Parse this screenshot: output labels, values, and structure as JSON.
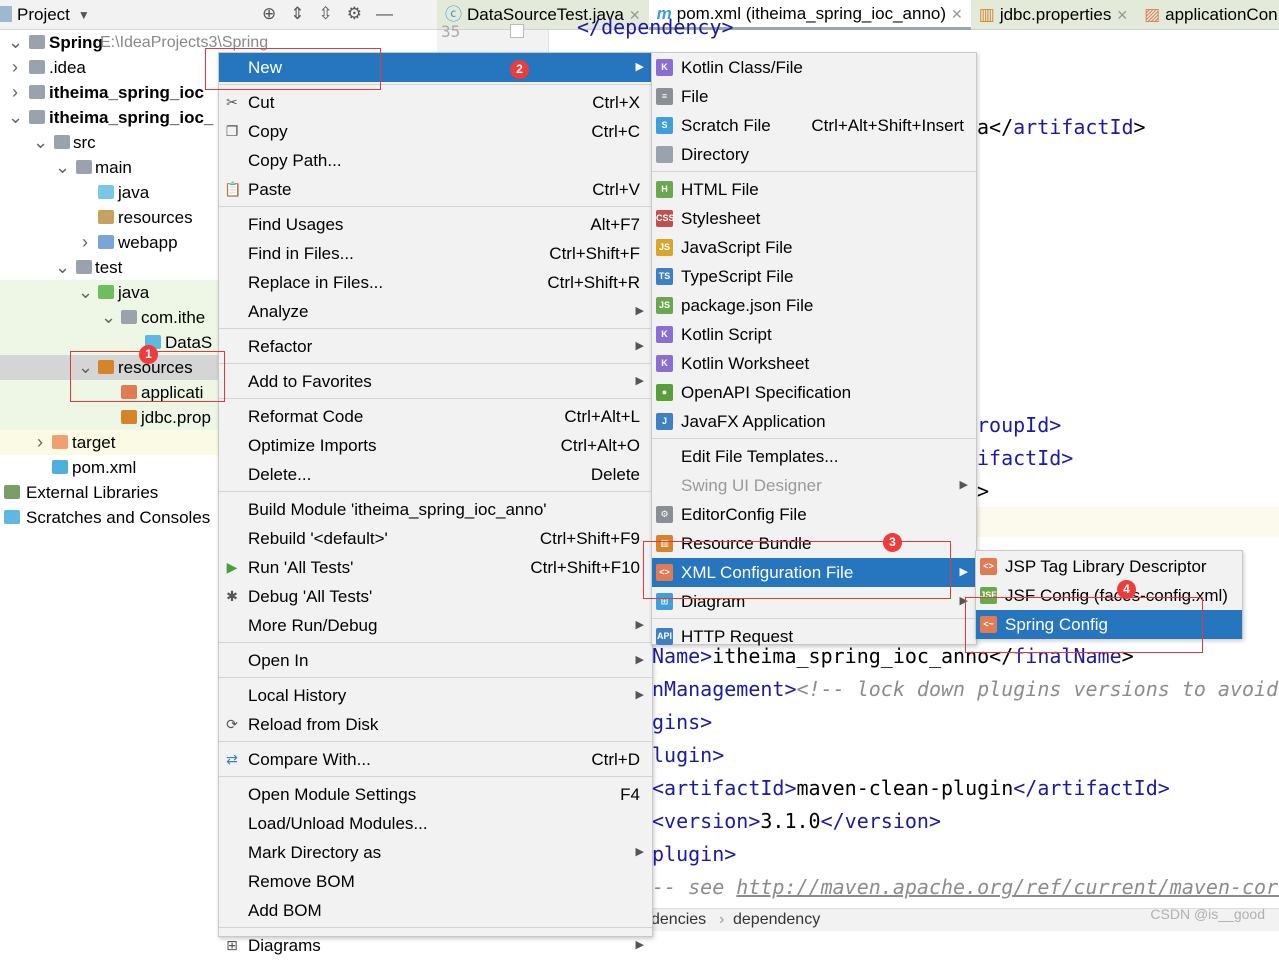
{
  "project_panel": {
    "title": "Project",
    "tools": [
      "locate-icon",
      "expand-all-icon",
      "collapse-all-icon",
      "gear-icon",
      "minimize-icon"
    ]
  },
  "tree": [
    {
      "label": "Spring",
      "path": "E:\\IdeaProjects3\\Spring",
      "bold": true
    },
    {
      "label": ".idea"
    },
    {
      "label": "itheima_spring_ioc",
      "bold": true
    },
    {
      "label": "itheima_spring_ioc_",
      "bold": true
    },
    {
      "label": "src"
    },
    {
      "label": "main"
    },
    {
      "label": "java"
    },
    {
      "label": "resources"
    },
    {
      "label": "webapp"
    },
    {
      "label": "test"
    },
    {
      "label": "java"
    },
    {
      "label": "com.ithe"
    },
    {
      "label": "DataS"
    },
    {
      "label": "resources"
    },
    {
      "label": "applicati"
    },
    {
      "label": "jdbc.prop"
    },
    {
      "label": "target"
    },
    {
      "label": "pom.xml"
    },
    {
      "label": "External Libraries"
    },
    {
      "label": "Scratches and Consoles"
    }
  ],
  "tabs": [
    {
      "label": "DataSourceTest.java"
    },
    {
      "label": "pom.xml (itheima_spring_ioc_anno)",
      "active": true
    },
    {
      "label": "jdbc.properties"
    },
    {
      "label": "applicationCon"
    }
  ],
  "gutter": {
    "line": "35"
  },
  "code": {
    "l1": "</dependency>",
    "l2a": "a</",
    "l2b": "artifactId",
    "l2c": ">",
    "l3": "roupId>",
    "l4": "ifactId>",
    "l5": ">",
    "l6a": "Name>",
    "l6b": "itheima_spring_ioc_anno",
    "l6c": "</",
    "l6d": "finalName",
    "l6e": ">",
    "l7a": "nManagement>",
    "l7b": "<!-- lock down plugins versions to avoid",
    "l8": "gins>",
    "l9": "lugin>",
    "l10a": "<artifactId>",
    "l10b": "maven-clean-plugin",
    "l10c": "</artifactId>",
    "l11a": "<version>",
    "l11b": "3.1.0",
    "l11c": "</version>",
    "l12": "plugin>",
    "l13a": "-- see ",
    "l13b": "http://maven.apache.org/ref/current/maven-core"
  },
  "breadcrumb": [
    "dencies",
    "dependency"
  ],
  "watermark": "CSDN @is__good",
  "context_menu": [
    {
      "label": "New",
      "arrow": true,
      "highlighted": true
    },
    "sep",
    {
      "label": "Cut",
      "shortcut": "Ctrl+X",
      "icon": "scissors-icon"
    },
    {
      "label": "Copy",
      "shortcut": "Ctrl+C",
      "icon": "copy-icon"
    },
    {
      "label": "Copy Path..."
    },
    {
      "label": "Paste",
      "shortcut": "Ctrl+V",
      "icon": "paste-icon"
    },
    "sep",
    {
      "label": "Find Usages",
      "shortcut": "Alt+F7"
    },
    {
      "label": "Find in Files...",
      "shortcut": "Ctrl+Shift+F"
    },
    {
      "label": "Replace in Files...",
      "shortcut": "Ctrl+Shift+R"
    },
    {
      "label": "Analyze",
      "arrow": true
    },
    "sep",
    {
      "label": "Refactor",
      "arrow": true
    },
    "sep",
    {
      "label": "Add to Favorites",
      "arrow": true
    },
    "sep",
    {
      "label": "Reformat Code",
      "shortcut": "Ctrl+Alt+L"
    },
    {
      "label": "Optimize Imports",
      "shortcut": "Ctrl+Alt+O"
    },
    {
      "label": "Delete...",
      "shortcut": "Delete"
    },
    "sep",
    {
      "label": "Build Module 'itheima_spring_ioc_anno'"
    },
    {
      "label": "Rebuild '<default>'",
      "shortcut": "Ctrl+Shift+F9"
    },
    {
      "label": "Run 'All Tests'",
      "shortcut": "Ctrl+Shift+F10",
      "icon": "run-icon"
    },
    {
      "label": "Debug 'All Tests'",
      "icon": "debug-icon"
    },
    {
      "label": "More Run/Debug",
      "arrow": true
    },
    "sep",
    {
      "label": "Open In",
      "arrow": true
    },
    "sep",
    {
      "label": "Local History",
      "arrow": true
    },
    {
      "label": "Reload from Disk",
      "icon": "reload-icon"
    },
    "sep",
    {
      "label": "Compare With...",
      "shortcut": "Ctrl+D",
      "icon": "compare-icon"
    },
    "sep",
    {
      "label": "Open Module Settings",
      "shortcut": "F4"
    },
    {
      "label": "Load/Unload Modules..."
    },
    {
      "label": "Mark Directory as",
      "arrow": true
    },
    {
      "label": "Remove BOM"
    },
    {
      "label": "Add BOM"
    },
    "sep",
    {
      "label": "Diagrams",
      "arrow": true,
      "icon": "diagram-icon"
    }
  ],
  "new_menu": [
    {
      "label": "Kotlin Class/File",
      "icon": "K",
      "color": "#8a6fd1"
    },
    {
      "label": "File",
      "icon": "≡",
      "color": "#8a8f96"
    },
    {
      "label": "Scratch File",
      "shortcut": "Ctrl+Alt+Shift+Insert",
      "icon": "S",
      "color": "#3f9fd8"
    },
    {
      "label": "Directory",
      "icon": "",
      "color": "#9aa3ad"
    },
    "sep",
    {
      "label": "HTML File",
      "icon": "H",
      "color": "#6aa84f"
    },
    {
      "label": "Stylesheet",
      "icon": "CSS",
      "color": "#c0504d"
    },
    {
      "label": "JavaScript File",
      "icon": "JS",
      "color": "#d6a72b"
    },
    {
      "label": "TypeScript File",
      "icon": "TS",
      "color": "#3f7fc4"
    },
    {
      "label": "package.json File",
      "icon": "JS",
      "color": "#6aa84f"
    },
    {
      "label": "Kotlin Script",
      "icon": "K",
      "color": "#8a6fd1"
    },
    {
      "label": "Kotlin Worksheet",
      "icon": "K",
      "color": "#8a6fd1"
    },
    {
      "label": "OpenAPI Specification",
      "icon": "●",
      "color": "#5a9e3a"
    },
    {
      "label": "JavaFX Application",
      "icon": "J",
      "color": "#3f7fc4"
    },
    "sep",
    {
      "label": "Edit File Templates..."
    },
    {
      "label": "Swing UI Designer",
      "arrow": true,
      "disabled": true
    },
    {
      "label": "EditorConfig File",
      "icon": "⚙",
      "color": "#8a8f96"
    },
    {
      "label": "Resource Bundle",
      "icon": "▥",
      "color": "#d6842b"
    },
    {
      "label": "XML Configuration File",
      "arrow": true,
      "highlighted": true,
      "icon": "<>",
      "color": "#e07b53"
    },
    {
      "label": "Diagram",
      "arrow": true,
      "icon": "⊞",
      "color": "#3f9fd8"
    },
    "sep",
    {
      "label": "HTTP Request",
      "icon": "API",
      "color": "#3f7fc4"
    }
  ],
  "xml_menu": [
    {
      "label": "JSP Tag Library Descriptor",
      "icon": "<>",
      "color": "#e07b53"
    },
    {
      "label": "JSF Config (faces-config.xml)",
      "icon": "JSF",
      "color": "#6aa84f"
    },
    {
      "label": "Spring Config",
      "highlighted": true,
      "icon": "<~",
      "color": "#e07b53"
    }
  ],
  "badges": [
    "1",
    "2",
    "3",
    "4"
  ],
  "colors": {
    "highlight": "#2675bf",
    "annotation": "#e53935"
  }
}
